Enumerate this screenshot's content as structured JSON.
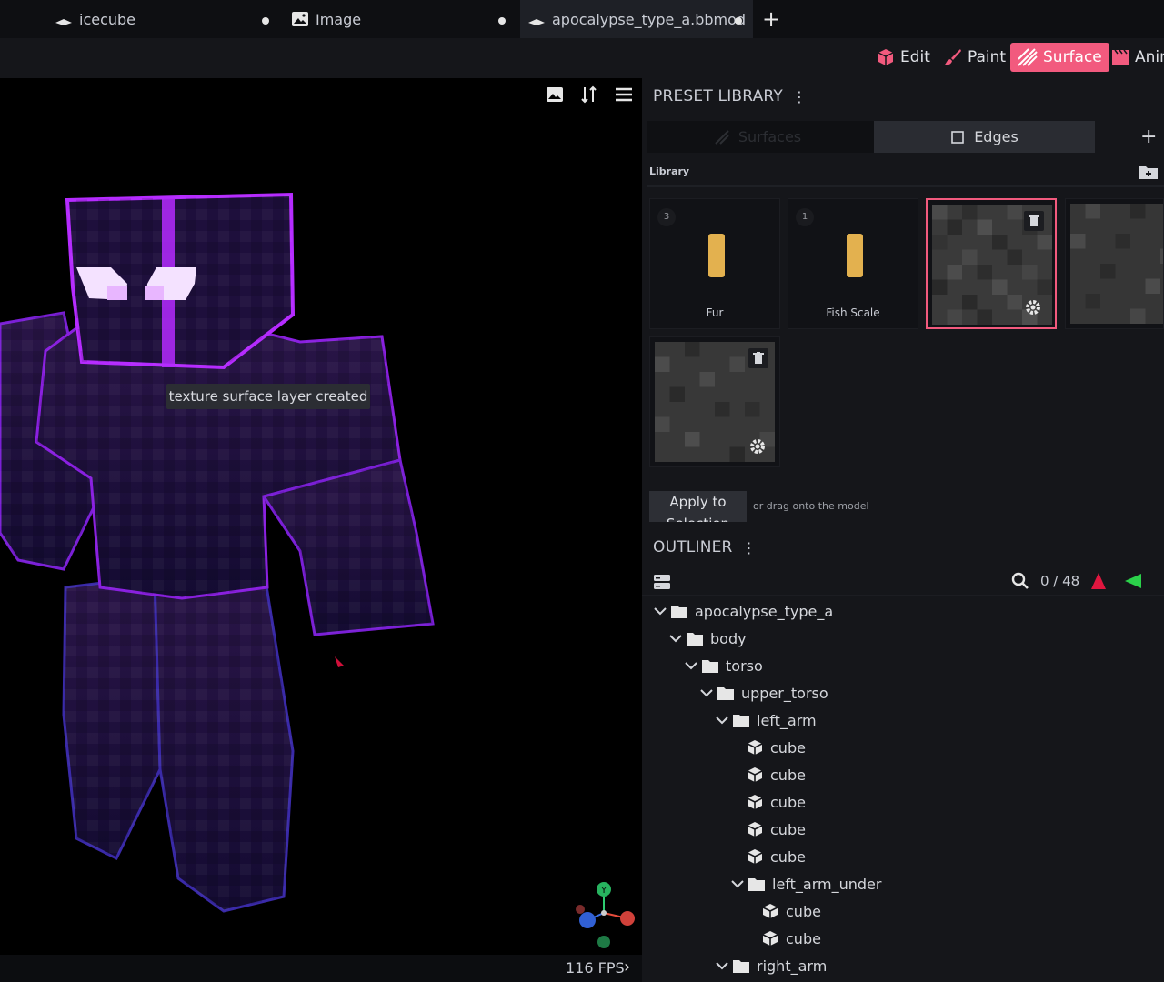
{
  "tabs": [
    {
      "label": "icecube",
      "unsaved": true
    },
    {
      "label": "Image",
      "unsaved": true
    },
    {
      "label": "apocalypse_type_a.bbmod",
      "unsaved": true,
      "active": true
    }
  ],
  "modes": {
    "edit": "Edit",
    "paint": "Paint",
    "surface": "Surface",
    "animate": "Anim",
    "active": "surface",
    "accent": "#f25a7e"
  },
  "viewport": {
    "toast": "texture surface layer created",
    "fps": "116 FPS",
    "gizmo_y_label": "Y"
  },
  "preset_library": {
    "title": "PRESET LIBRARY",
    "tabs": {
      "surfaces": "Surfaces",
      "edges": "Edges"
    },
    "section": "Library",
    "cards": [
      {
        "badge": "3",
        "label": "Fur",
        "swatch": "#e3b14f"
      },
      {
        "badge": "1",
        "label": "Fish Scale",
        "swatch": "#e3b14f"
      }
    ],
    "apply_button": "Apply to Selection",
    "hint": "or drag onto the model"
  },
  "outliner": {
    "title": "OUTLINER",
    "count": "0 / 48",
    "tree": [
      {
        "label": "apocalypse_type_a",
        "type": "folder",
        "depth": 0
      },
      {
        "label": "body",
        "type": "folder",
        "depth": 1
      },
      {
        "label": "torso",
        "type": "folder",
        "depth": 2
      },
      {
        "label": "upper_torso",
        "type": "folder",
        "depth": 3
      },
      {
        "label": "left_arm",
        "type": "folder",
        "depth": 4
      },
      {
        "label": "cube",
        "type": "cube",
        "depth": 5
      },
      {
        "label": "cube",
        "type": "cube",
        "depth": 5
      },
      {
        "label": "cube",
        "type": "cube",
        "depth": 5
      },
      {
        "label": "cube",
        "type": "cube",
        "depth": 5
      },
      {
        "label": "cube",
        "type": "cube",
        "depth": 5
      },
      {
        "label": "left_arm_under",
        "type": "folder",
        "depth": 5
      },
      {
        "label": "cube",
        "type": "cube",
        "depth": 6
      },
      {
        "label": "cube",
        "type": "cube",
        "depth": 6
      },
      {
        "label": "right_arm",
        "type": "folder",
        "depth": 4
      }
    ]
  }
}
